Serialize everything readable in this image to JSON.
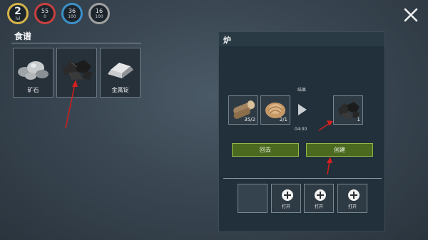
{
  "hud": {
    "level": {
      "value": "2",
      "sub": "lvl"
    },
    "health": {
      "value": "55",
      "sub": "0"
    },
    "water": {
      "value": "36",
      "sub": "100"
    },
    "stamina": {
      "value": "16",
      "sub": "100"
    }
  },
  "recipes": {
    "title": "食谱",
    "items": [
      {
        "label": "矿石",
        "icon": "ore-icon"
      },
      {
        "label": "",
        "icon": "coal-icon"
      },
      {
        "label": "金属锭",
        "icon": "ingot-icon"
      }
    ]
  },
  "furnace": {
    "title": "炉",
    "result_label": "结果",
    "inputs": [
      {
        "count": "35/2",
        "icon": "log-icon"
      },
      {
        "count": "2/1",
        "icon": "fiber-icon"
      }
    ],
    "output": {
      "count": "1",
      "icon": "coal-icon"
    },
    "timer": "04:00",
    "back_label": "回去",
    "create_label": "创建",
    "add_slots": [
      {
        "label": "打开"
      },
      {
        "label": "打开"
      },
      {
        "label": "打开"
      }
    ]
  },
  "colors": {
    "button": "#4b6a1f",
    "button_border": "#93b84a",
    "panel": "#21303a",
    "annotation": "#d21f1f"
  }
}
